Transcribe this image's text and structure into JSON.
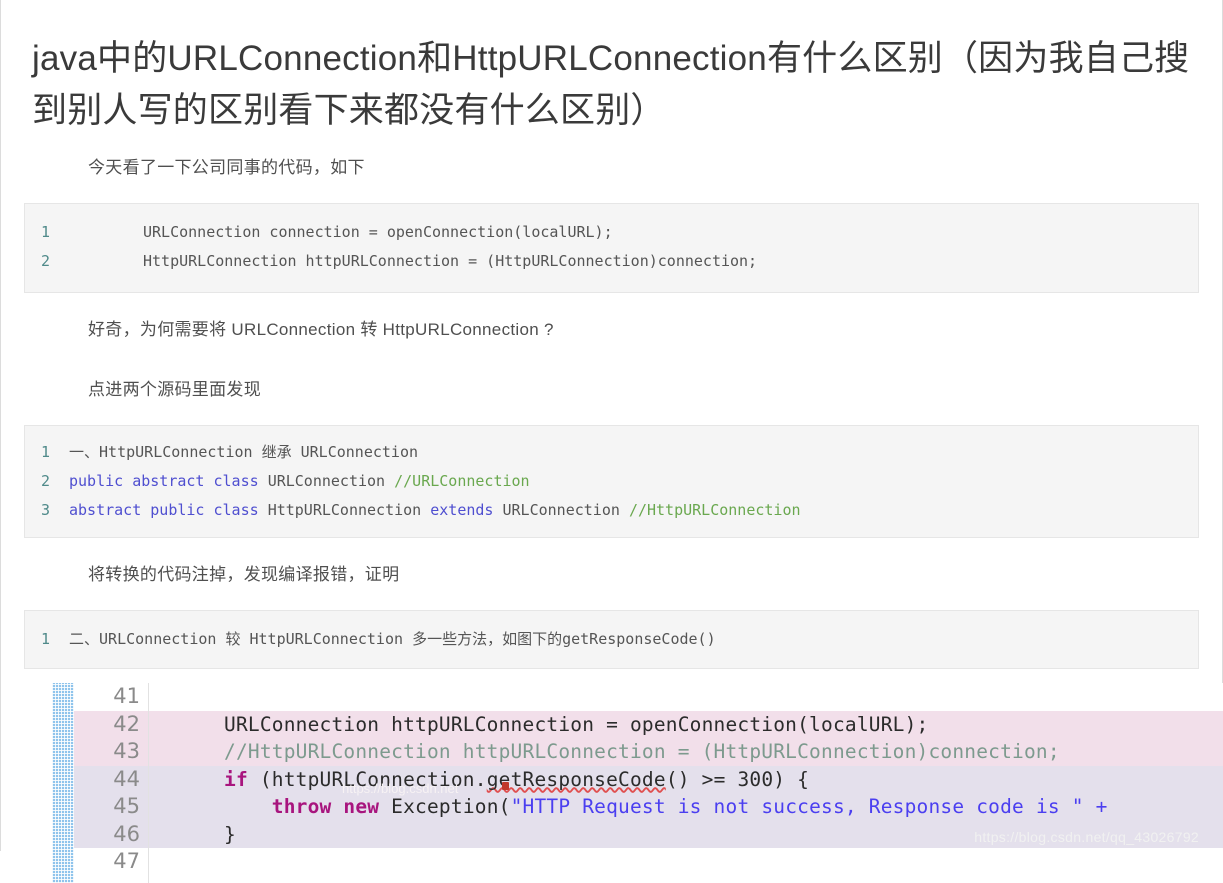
{
  "article": {
    "title": "java中的URLConnection和HttpURLConnection有什么区别（因为我自己搜到别人写的区别看下来都没有什么区别）",
    "paragraph_1": "今天看了一下公司同事的代码，如下",
    "paragraph_2": "好奇，为何需要将 URLConnection 转 HttpURLConnection ?",
    "paragraph_3": "点进两个源码里面发现",
    "paragraph_4": "将转换的代码注掉，发现编译报错，证明"
  },
  "code_block_1": {
    "lines": [
      {
        "num": "1",
        "text": "URLConnection connection = openConnection(localURL);"
      },
      {
        "num": "2",
        "text": "HttpURLConnection httpURLConnection = (HttpURLConnection)connection;"
      }
    ]
  },
  "code_block_2": {
    "lines": [
      {
        "num": "1",
        "tokens": [
          {
            "t": "一、",
            "c": "cn"
          },
          {
            "t": "HttpURLConnection ",
            "c": "plain"
          },
          {
            "t": "继承",
            "c": "cn"
          },
          {
            "t": " URLConnection",
            "c": "plain"
          }
        ]
      },
      {
        "num": "2",
        "tokens": [
          {
            "t": "public abstract class ",
            "c": "kw"
          },
          {
            "t": "URLConnection ",
            "c": "plain"
          },
          {
            "t": "//URLConnection",
            "c": "cm"
          }
        ]
      },
      {
        "num": "3",
        "tokens": [
          {
            "t": "abstract public class ",
            "c": "kw"
          },
          {
            "t": "HttpURLConnection ",
            "c": "plain"
          },
          {
            "t": "extends ",
            "c": "kw"
          },
          {
            "t": "URLConnection ",
            "c": "plain"
          },
          {
            "t": "//HttpURLConnection",
            "c": "cm"
          }
        ]
      }
    ]
  },
  "code_block_3": {
    "lines": [
      {
        "num": "1",
        "tokens": [
          {
            "t": "二、",
            "c": "cn"
          },
          {
            "t": "URLConnection ",
            "c": "plain"
          },
          {
            "t": "较",
            "c": "cn"
          },
          {
            "t": " HttpURLConnection ",
            "c": "plain"
          },
          {
            "t": "多一些方法，如图下的",
            "c": "cn"
          },
          {
            "t": "getResponseCode()",
            "c": "plain"
          }
        ]
      }
    ]
  },
  "ide": {
    "rows": [
      {
        "num": "41",
        "highlight": "none",
        "error": false,
        "tokens": []
      },
      {
        "num": "42",
        "highlight": "pink",
        "error": false,
        "tokens": [
          {
            "t": "URLConnection httpURLConnection = openConnection(localURL);",
            "c": "pl"
          }
        ]
      },
      {
        "num": "43",
        "highlight": "pink",
        "error": false,
        "tokens": [
          {
            "t": "//HttpURLConnection httpURLConnection = (HttpURLConnection)connection;",
            "c": "cm"
          }
        ]
      },
      {
        "num": "44",
        "highlight": "lav",
        "error": true,
        "tokens": [
          {
            "t": "if",
            "c": "kw"
          },
          {
            "t": " (httpURLConnection.",
            "c": "pl"
          },
          {
            "t": "getResponseCode",
            "c": "err"
          },
          {
            "t": "() >= 300) {",
            "c": "pl"
          }
        ]
      },
      {
        "num": "45",
        "highlight": "lav",
        "error": true,
        "tokens": [
          {
            "t": "    ",
            "c": "pl"
          },
          {
            "t": "throw new",
            "c": "kw"
          },
          {
            "t": " Exception(",
            "c": "pl"
          },
          {
            "t": "\"HTTP Request is not success, Response code is \" +",
            "c": "str"
          }
        ]
      },
      {
        "num": "46",
        "highlight": "lav",
        "error": false,
        "tokens": [
          {
            "t": "}",
            "c": "pl"
          }
        ]
      },
      {
        "num": "47",
        "highlight": "none",
        "error": false,
        "tokens": []
      }
    ]
  },
  "watermark": {
    "url": "https://blog.csdn.net/qq_43026792",
    "url_inline": "https://blog.csdn.net"
  }
}
